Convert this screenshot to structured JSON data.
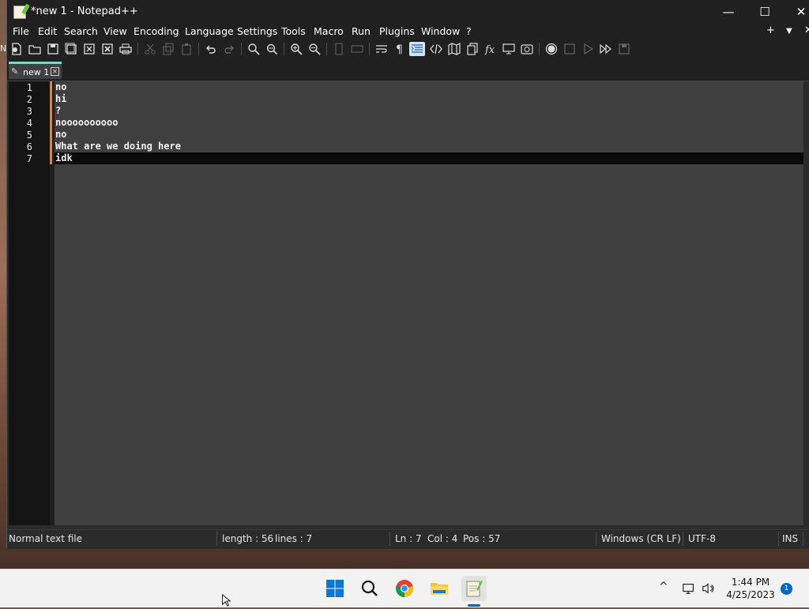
{
  "window": {
    "title": "*new 1 - Notepad++",
    "controls": {
      "minimize": "—",
      "maximize": "☐",
      "close": "✕"
    }
  },
  "menubar": {
    "items": [
      "File",
      "Edit",
      "Search",
      "View",
      "Encoding",
      "Language",
      "Settings",
      "Tools",
      "Macro",
      "Run",
      "Plugins",
      "Window",
      "?"
    ],
    "right": {
      "add": "+",
      "dropdown": "▼",
      "close": "✕"
    }
  },
  "toolbar": {
    "buttons": [
      "new-file",
      "open-file",
      "save",
      "save-all",
      "close",
      "close-all",
      "print",
      "cut",
      "copy",
      "paste",
      "undo",
      "redo",
      "find",
      "replace",
      "zoom-in",
      "zoom-out",
      "sync-vertical",
      "sync-horizontal",
      "word-wrap",
      "show-all-characters",
      "indent-guide",
      "user-defined-language",
      "document-map",
      "document-list",
      "function-list",
      "folder-as-workspace",
      "monitoring",
      "record-macro",
      "stop-recording",
      "playback",
      "run-macro-multiple",
      "save-macro"
    ]
  },
  "tabs": [
    {
      "label": "new 1",
      "modified_icon": "✎",
      "close": "✕"
    }
  ],
  "editor": {
    "line_numbers": [
      "1",
      "2",
      "3",
      "4",
      "5",
      "6",
      "7"
    ],
    "lines": [
      "no",
      "hi",
      "?",
      "noooooooooo",
      "no",
      "What are we doing here",
      "idk"
    ],
    "current_line": 7
  },
  "statusbar": {
    "file_type": "Normal text file",
    "length": "length : 56",
    "lines": "lines : 7",
    "ln": "Ln : 7",
    "col": "Col : 4",
    "pos": "Pos : 57",
    "eol": "Windows (CR LF)",
    "encoding": "UTF-8",
    "mode": "INS"
  },
  "taskbar": {
    "apps": [
      "start",
      "search",
      "chrome",
      "file-explorer",
      "notepad-plus-plus"
    ],
    "tray": {
      "chevron": "^",
      "network": "network-icon",
      "volume": "volume-icon"
    },
    "clock": {
      "time": "1:44 PM",
      "date": "4/25/2023"
    },
    "notification_count": "1"
  },
  "colors": {
    "accent_change_bar": "#f27d2c",
    "tab_accent": "#7fd4c4",
    "taskbar_active": "#0067c0"
  }
}
